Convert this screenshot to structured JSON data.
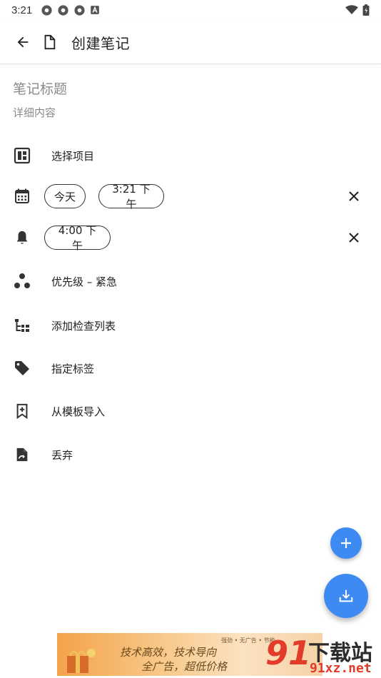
{
  "status_bar": {
    "time": "3:21"
  },
  "app_bar": {
    "title": "创建笔记"
  },
  "note": {
    "title_placeholder": "笔记标题",
    "body_placeholder": "详细内容"
  },
  "rows": {
    "project": {
      "label": "选择项目"
    },
    "date": {
      "date_chip": "今天",
      "time_chip": "3:21 下午"
    },
    "reminder": {
      "time_chip": "4:00 下午"
    },
    "priority": {
      "label": "优先级 – 紧急"
    },
    "checklist": {
      "label": "添加检查列表"
    },
    "tags": {
      "label": "指定标签"
    },
    "template": {
      "label": "从模板导入"
    },
    "discard": {
      "label": "丢弃"
    }
  },
  "ad": {
    "line1": "技术高效，技术导向",
    "line2": "全广告，超低价格",
    "sub": "强劲 • 无广告 • 节能"
  },
  "watermark": {
    "logo": "91",
    "name": "下载站",
    "url": "91xz.net"
  },
  "colors": {
    "accent": "#3d8bf2",
    "icon": "#333333",
    "watermark_red": "#e23b2a"
  }
}
